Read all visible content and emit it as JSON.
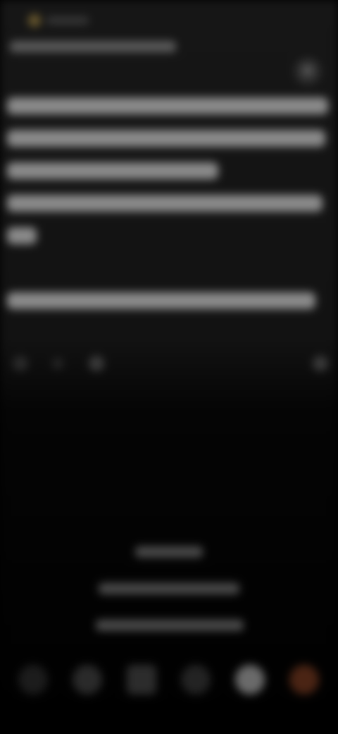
{
  "screen": {
    "blurred": true
  },
  "colors": {
    "background": "#121212",
    "text_placeholder": "#8a8a8a",
    "accent": "#4a2414"
  },
  "icons": {
    "close": "close-icon",
    "avatar": "avatar-dot"
  }
}
